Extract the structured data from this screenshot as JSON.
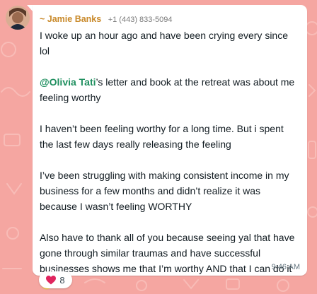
{
  "message": {
    "sender_prefix": "~ ",
    "sender_name": "Jamie Banks",
    "sender_phone": "+1 (443) 833-5094",
    "paragraphs": {
      "p1": "I woke up an hour ago and have been crying every since lol",
      "p2_mention": "@Olivia Tati",
      "p2_rest": "’s letter and book at the retreat was about me feeling worthy",
      "p3": "I haven’t been feeling worthy for a long time. But i spent the last few days really releasing the feeling",
      "p4": "I’ve been struggling with making consistent income in my business for a few months and didn’t realize it was because I wasn’t feeling WORTHY",
      "p5": "Also have to thank all of you because seeing yal that have gone through similar traumas and have successful businesses shows me that I’m worthy AND that I can do it"
    },
    "emoji": "pleading-face-icon",
    "time": "9:46 AM"
  },
  "reaction": {
    "icon": "red-heart-icon",
    "count": "8"
  },
  "colors": {
    "background": "#f5a6a1",
    "sender": "#c98a2b",
    "mention": "#1f8f5f",
    "heart": "#e0245e"
  }
}
